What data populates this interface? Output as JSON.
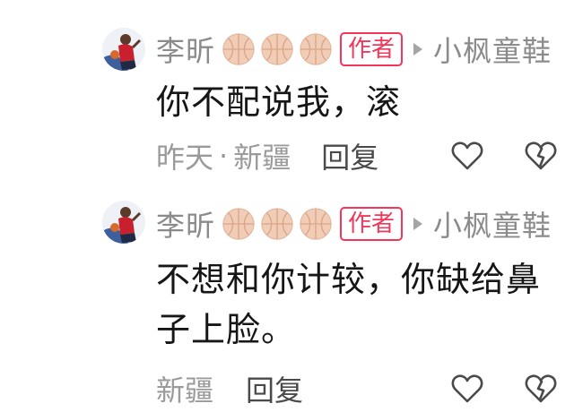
{
  "comments": [
    {
      "author": "李昕",
      "badge_icon": "basketball-icon",
      "badge_count": 3,
      "author_tag": "作者",
      "reply_to": "小枫童鞋",
      "content": "你不配说我，滚",
      "time": "昨天",
      "separator": "·",
      "location": "新疆",
      "reply_label": "回复"
    },
    {
      "author": "李昕",
      "badge_icon": "basketball-icon",
      "badge_count": 3,
      "author_tag": "作者",
      "reply_to": "小枫童鞋",
      "content": "不想和你计较，你缺给鼻子上脸。",
      "location": "新疆",
      "reply_label": "回复"
    }
  ],
  "colors": {
    "author_tag": "#f4365a",
    "meta_text": "#9a9a9a",
    "content_text": "#161616",
    "icon_stroke": "#4a4a4a",
    "badge_fill": "#f1cdb8"
  }
}
